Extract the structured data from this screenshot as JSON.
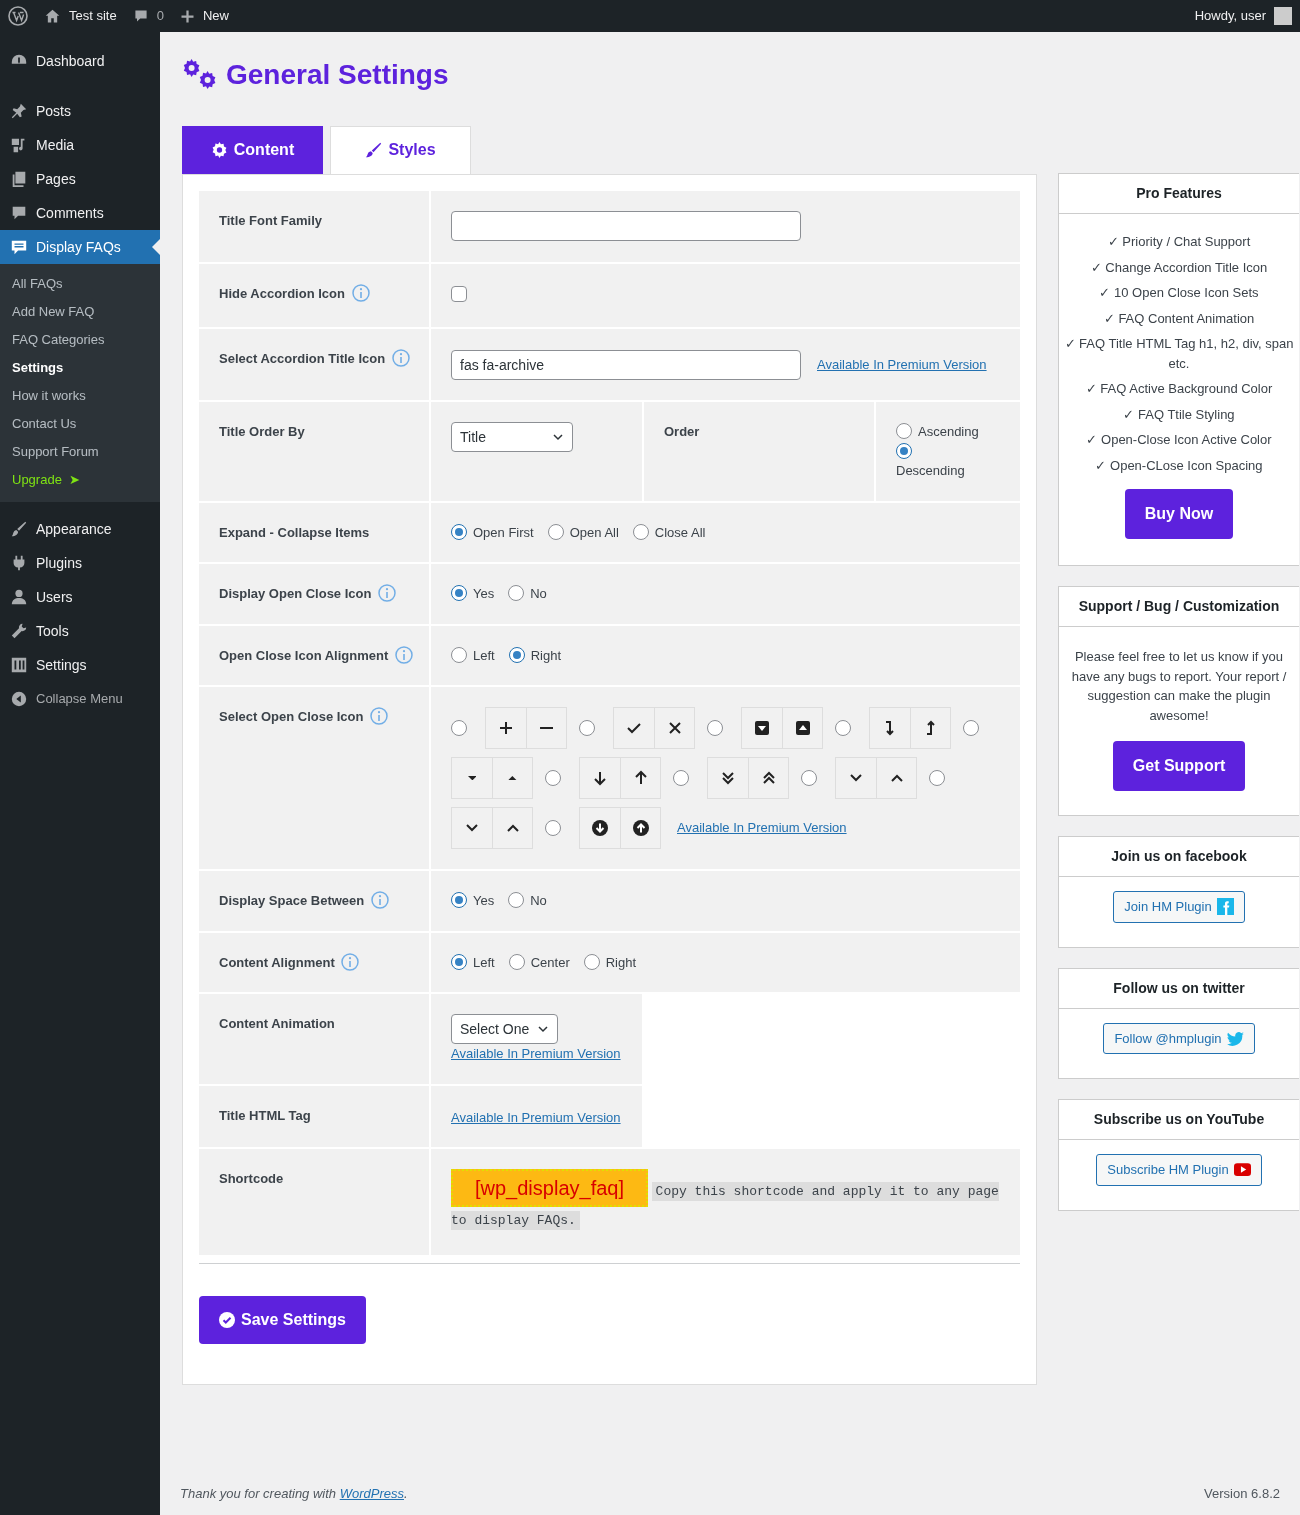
{
  "admin_bar": {
    "site": "Test site",
    "comments": "0",
    "new": "New",
    "greeting": "Howdy, user"
  },
  "sidebar": {
    "items": [
      {
        "label": "Dashboard",
        "kind": "dashboard",
        "selected": false
      },
      {
        "label": "Posts",
        "kind": "posts",
        "selected": false
      },
      {
        "label": "Media",
        "kind": "media",
        "selected": false
      },
      {
        "label": "Pages",
        "kind": "pages",
        "selected": false
      },
      {
        "label": "Comments",
        "kind": "comments",
        "selected": false
      },
      {
        "label": "Display FAQs",
        "kind": "faq",
        "selected": true,
        "children": [
          {
            "label": "All FAQs",
            "selected": false
          },
          {
            "label": "Add New FAQ",
            "selected": false
          },
          {
            "label": "FAQ Categories",
            "selected": false
          },
          {
            "label": "Settings",
            "selected": true
          },
          {
            "label": "How it works",
            "selected": false
          },
          {
            "label": "Contact Us",
            "selected": false
          },
          {
            "label": "Support Forum",
            "selected": false
          },
          {
            "label": "Upgrade",
            "selected": false,
            "kind": "upgrade",
            "suffix": "➤"
          }
        ]
      },
      {
        "label": "Appearance",
        "kind": "appearance",
        "selected": false
      },
      {
        "label": "Plugins",
        "kind": "plugins",
        "selected": false
      },
      {
        "label": "Users",
        "kind": "users",
        "selected": false
      },
      {
        "label": "Tools",
        "kind": "tools",
        "selected": false
      },
      {
        "label": "Settings",
        "kind": "settings",
        "selected": false
      },
      {
        "label": "Collapse Menu",
        "kind": "collapse",
        "selected": false
      }
    ]
  },
  "page_title": "General Settings",
  "tabs": [
    {
      "label": "Content",
      "kind": "gear",
      "selected": true
    },
    {
      "label": "Styles",
      "kind": "brush",
      "selected": false
    }
  ],
  "settings": [
    {
      "label": "Title Font Family",
      "info": false,
      "kind": "text"
    },
    {
      "label": "Hide Accordion Icon",
      "info": true,
      "kind": "checkbox",
      "checked": false
    },
    {
      "label": "Select Accordion Title Icon",
      "info": true,
      "kind": "text",
      "value": "fas fa-archive",
      "link": "Available In Premium Version"
    },
    {
      "label": "Title Order By",
      "info": false,
      "kind": "order",
      "select": "Title",
      "order_label": "Order",
      "options": [
        {
          "label": "Ascending",
          "selected": false
        },
        {
          "label": "Descending",
          "selected": true
        }
      ]
    },
    {
      "label": "Expand - Collapse Items",
      "info": false,
      "kind": "radios",
      "options": [
        {
          "label": "Open First",
          "selected": true
        },
        {
          "label": "Open All",
          "selected": false
        },
        {
          "label": "Close All",
          "selected": false
        }
      ]
    },
    {
      "label": "Display Open Close Icon",
      "info": true,
      "kind": "radios",
      "options": [
        {
          "label": "Yes",
          "selected": true
        },
        {
          "label": "No",
          "selected": false
        }
      ]
    },
    {
      "label": "Open Close Icon Alignment",
      "info": true,
      "kind": "radios",
      "options": [
        {
          "label": "Left",
          "selected": false
        },
        {
          "label": "Right",
          "selected": true
        }
      ]
    },
    {
      "label": "Select Open Close Icon",
      "info": true,
      "kind": "icon_sets",
      "link": "Available In Premium Version",
      "sets": [
        {
          "kind": "plus-minus",
          "selected": false
        },
        {
          "kind": "check-times",
          "selected": false
        },
        {
          "kind": "caret-square",
          "selected": false
        },
        {
          "kind": "level",
          "selected": false
        },
        {
          "kind": "caret",
          "selected": false
        },
        {
          "kind": "arrow",
          "selected": false
        },
        {
          "kind": "double-chevron",
          "selected": false
        },
        {
          "kind": "chevron",
          "selected": false
        },
        {
          "kind": "chevron",
          "selected": false
        },
        {
          "kind": "arrow-circle",
          "selected": false
        }
      ]
    },
    {
      "label": "Display Space Between",
      "info": true,
      "kind": "radios",
      "options": [
        {
          "label": "Yes",
          "selected": true
        },
        {
          "label": "No",
          "selected": false
        }
      ]
    },
    {
      "label": "Content Alignment",
      "info": true,
      "kind": "radios",
      "options": [
        {
          "label": "Left",
          "selected": true
        },
        {
          "label": "Center",
          "selected": false
        },
        {
          "label": "Right",
          "selected": false
        }
      ]
    },
    {
      "label": "Content Animation",
      "info": false,
      "kind": "select",
      "select": "Select One",
      "link": "Available In Premium Version"
    },
    {
      "label": "Title HTML Tag",
      "info": false,
      "kind": "link",
      "link": "Available In Premium Version"
    },
    {
      "label": "Shortcode",
      "info": false,
      "kind": "shortcode",
      "code": "[wp_display_faq]",
      "note": "Copy this shortcode and apply it to any page to display FAQs."
    }
  ],
  "save_button": "Save Settings",
  "cards": [
    {
      "title": "Pro Features",
      "kind": "features",
      "items": [
        "✓ Priority / Chat Support",
        "✓ Change Accordion Title Icon",
        "✓ 10 Open Close Icon Sets",
        "✓ FAQ Content Animation",
        "✓ FAQ Title HTML Tag h1, h2, div, span etc.",
        "✓ FAQ Active Background Color",
        "✓ FAQ Ttile Styling",
        "✓ Open-Close Icon Active Color",
        "✓ Open-CLose Icon Spacing"
      ],
      "button": "Buy Now"
    },
    {
      "title": "Support / Bug / Customization",
      "kind": "support",
      "text": "Please feel free to let us know if you have any bugs to report. Your report / suggestion can make the plugin awesome!",
      "button": "Get Support"
    },
    {
      "title": "Join us on facebook",
      "kind": "facebook",
      "button": "Join HM Plugin"
    },
    {
      "title": "Follow us on twitter",
      "kind": "twitter",
      "button": "Follow @hmplugin"
    },
    {
      "title": "Subscribe us on YouTube",
      "kind": "youtube",
      "button": "Subscribe HM Plugin"
    }
  ],
  "footer": {
    "text": "Thank you for creating with ",
    "link": "WordPress",
    "after": ".",
    "version": "Version 6.8.2"
  }
}
